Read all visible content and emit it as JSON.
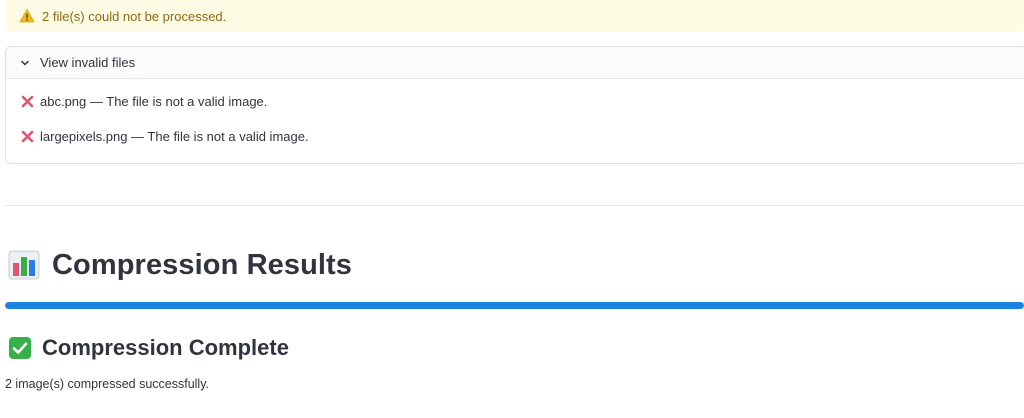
{
  "warning": {
    "icon": "warning-triangle-icon",
    "text": "2 file(s) could not be processed."
  },
  "expander": {
    "label": "View invalid files",
    "expanded": true,
    "errors": [
      {
        "icon": "cross-mark-icon",
        "text": "abc.png — The file is not a valid image."
      },
      {
        "icon": "cross-mark-icon",
        "text": "largepixels.png — The file is not a valid image."
      }
    ]
  },
  "results": {
    "icon": "bar-chart-icon",
    "title": "Compression Results",
    "progress_fraction": 1.0,
    "complete_icon": "check-mark-icon",
    "complete_title": "Compression Complete",
    "summary": "2 image(s) compressed successfully."
  },
  "colors": {
    "warning_bg": "#fffce6",
    "warning_text": "#8a6a14",
    "progress": "#1c83e1",
    "error_cross": "#e05571",
    "success_green": "#37b04a"
  }
}
